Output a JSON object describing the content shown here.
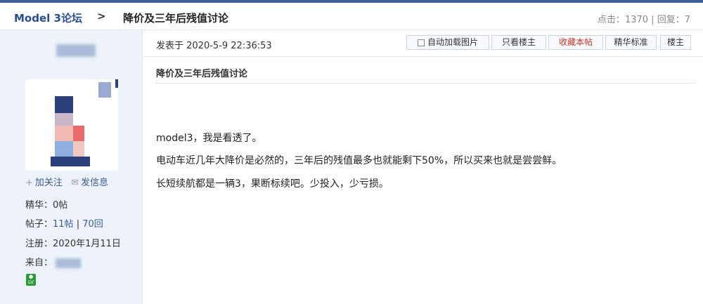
{
  "breadcrumb": {
    "forum": "Model 3论坛",
    "separator": ">",
    "thread_title": "降价及三年后残值讨论"
  },
  "stats": {
    "views_label": "点击：",
    "views": "1370",
    "divider": "|",
    "replies_label": "回复：",
    "replies": "7"
  },
  "author": {
    "follow": "加关注",
    "message": "发信息",
    "essence": "精华：0帖",
    "posts_label": "帖子：",
    "posts": "11帖",
    "replies_sep": "|",
    "replies": "70回",
    "registered": "注册：2020年1月11日",
    "from_label": "来自："
  },
  "post": {
    "posted_at": "发表于 2020-5-9 22:36:53",
    "toolbar": {
      "auto_load_images": "自动加载图片",
      "only_op": "只看楼主",
      "favorite": "收藏本帖",
      "essence_standard": "精华标准",
      "floor": "楼主"
    },
    "title": "降价及三年后残值讨论",
    "lines": [
      "model3，我是看透了。",
      "电动车近几年大降价是必然的，三年后的残值最多也就能剩下50%，所以买来也就是尝尝鲜。",
      "长短续航都是一辆3，果断标续吧。少投入，少亏损。"
    ]
  },
  "colors": {
    "accent": "#2a4f8f",
    "sidebar_bg": "#eef3fb",
    "favorite_red": "#c0392b",
    "level_badge": "#2e9a3a"
  }
}
